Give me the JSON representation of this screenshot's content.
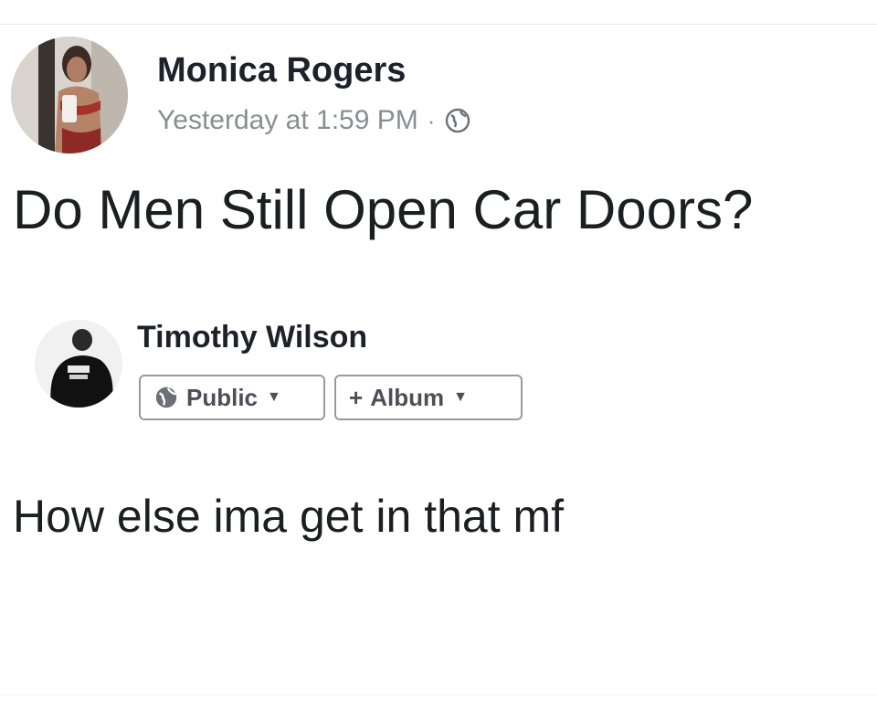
{
  "post": {
    "author": "Monica Rogers",
    "timestamp": "Yesterday at 1:59 PM",
    "separator": "·",
    "privacy_icon": "globe-icon",
    "text": "Do Men Still Open Car Doors?"
  },
  "comment": {
    "author": "Timothy Wilson",
    "audience_label": "Public",
    "audience_icon": "globe-icon",
    "album_plus": "+",
    "album_label": "Album",
    "caret": "▼",
    "text": "How else ima get in that mf"
  },
  "colors": {
    "name": "#1d2129",
    "meta": "#8a8d91",
    "pill_border": "#9a9a9a"
  }
}
